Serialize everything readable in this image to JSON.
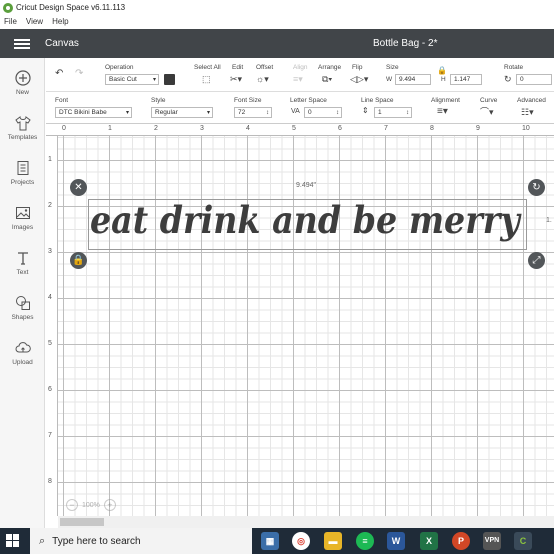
{
  "window": {
    "title": "Cricut Design Space  v6.11.113"
  },
  "menu": [
    "File",
    "View",
    "Help"
  ],
  "header": {
    "section": "Canvas",
    "document_title": "Bottle Bag - 2*"
  },
  "sidebar": {
    "items": [
      {
        "label": "New",
        "icon": "plus-circle-icon"
      },
      {
        "label": "Templates",
        "icon": "shirt-icon"
      },
      {
        "label": "Projects",
        "icon": "projects-icon"
      },
      {
        "label": "Images",
        "icon": "image-icon"
      },
      {
        "label": "Text",
        "icon": "text-icon"
      },
      {
        "label": "Shapes",
        "icon": "shapes-icon"
      },
      {
        "label": "Upload",
        "icon": "upload-cloud-icon"
      }
    ]
  },
  "toolbar": {
    "operation": {
      "label": "Operation",
      "value": "Basic Cut",
      "color": "#3a3a3a"
    },
    "select_all": "Select All",
    "edit": "Edit",
    "offset": "Offset",
    "align": "Align",
    "arrange": "Arrange",
    "flip": "Flip",
    "size": {
      "label": "Size",
      "w_label": "W",
      "w": "9.494",
      "h_label": "H",
      "h": "1.147"
    },
    "rotate": {
      "label": "Rotate",
      "value": "0"
    }
  },
  "text_toolbar": {
    "font": {
      "label": "Font",
      "value": "DTC Bikini Babe"
    },
    "style": {
      "label": "Style",
      "value": "Regular"
    },
    "font_size": {
      "label": "Font Size",
      "value": "72"
    },
    "letter_space": {
      "label": "Letter Space",
      "value": "0"
    },
    "line_space": {
      "label": "Line Space",
      "value": "1"
    },
    "alignment": "Alignment",
    "curve": "Curve",
    "advanced": "Advanced"
  },
  "ruler": {
    "top": [
      "0",
      "1",
      "2",
      "3",
      "4",
      "5",
      "6",
      "7",
      "8",
      "9",
      "10"
    ],
    "left": [
      "1",
      "2",
      "3",
      "4",
      "5",
      "6",
      "7",
      "8"
    ]
  },
  "canvas": {
    "text": "eat drink and be merry",
    "width_readout": "9.494\"",
    "height_readout": "1.",
    "zoom": "100%"
  },
  "taskbar": {
    "search_placeholder": "Type here to search",
    "apps": [
      "calendar-app-icon",
      "chrome-icon",
      "explorer-icon",
      "spotify-icon",
      "word-icon",
      "excel-icon",
      "powerpoint-icon",
      "vpn-icon",
      "cricut-icon"
    ]
  }
}
